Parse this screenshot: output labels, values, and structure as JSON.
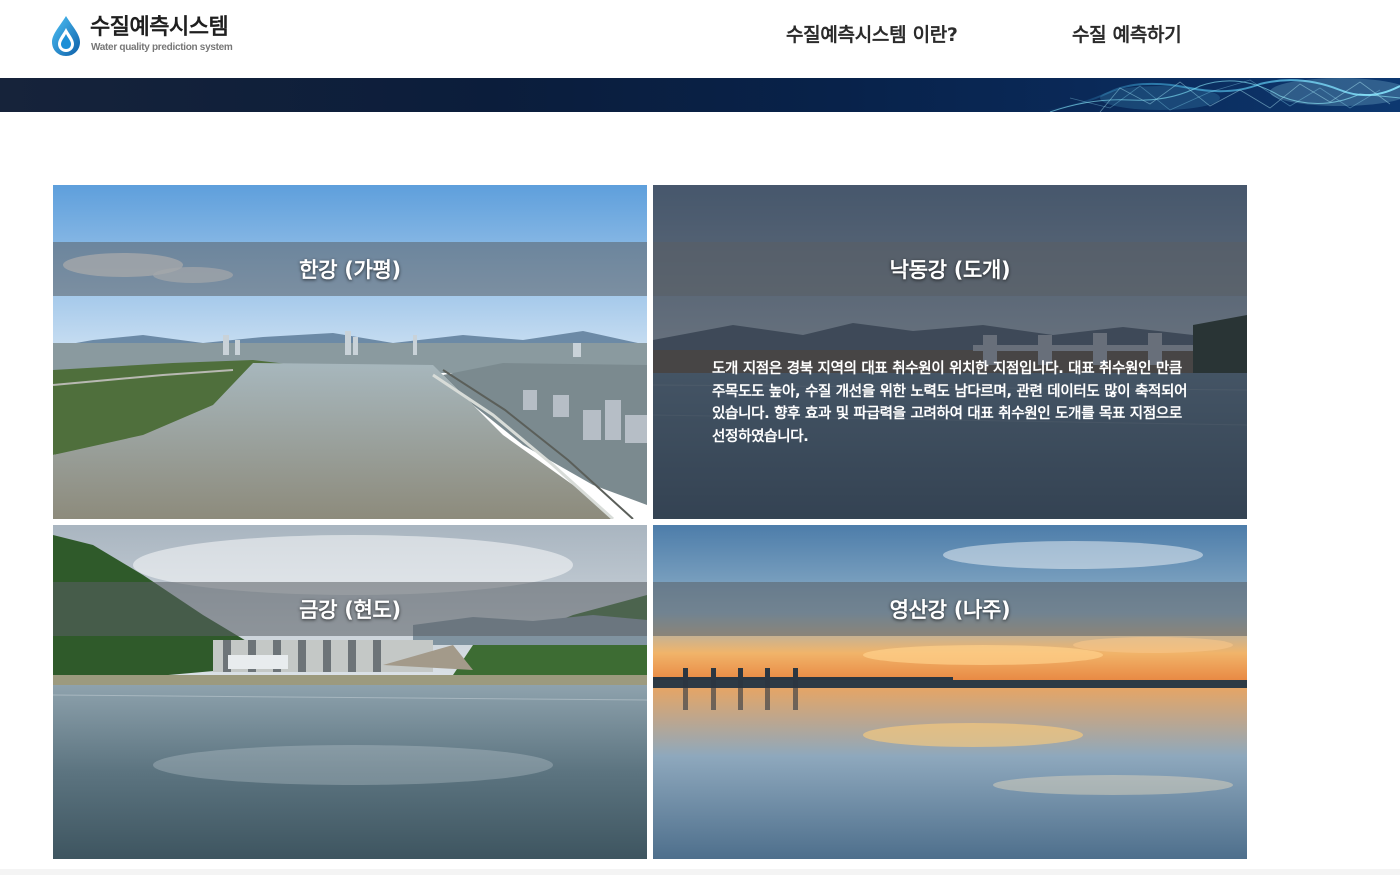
{
  "header": {
    "logo_title": "수질예측시스템",
    "logo_subtitle": "Water quality prediction system",
    "nav": [
      {
        "label": "수질예측시스템 이란?"
      },
      {
        "label": "수질 예측하기"
      }
    ]
  },
  "sites": [
    {
      "label": "한강 (가평)"
    },
    {
      "label": "낙동강 (도개)",
      "description": "도개 지점은 경북 지역의 대표 취수원이 위치한 지점입니다. 대표 취수원인 만큼 주목도도 높아, 수질 개선을 위한 노력도 남다르며, 관련 데이터도 많이 축적되어 있습니다. 향후 효과 및 파급력을 고려하여 대표 취수원인 도개를 목표 지점으로 선정하였습니다."
    },
    {
      "label": "금강 (현도)"
    },
    {
      "label": "영산강 (나주)"
    }
  ],
  "colors": {
    "accent": "#1d8fd6",
    "banner": "#0b1d3b"
  }
}
